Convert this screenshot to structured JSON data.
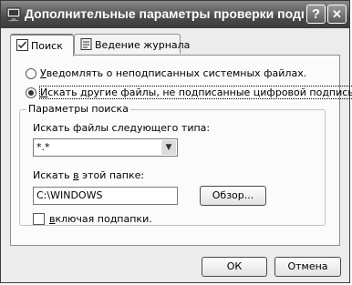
{
  "window": {
    "title": "Дополнительные параметры проверки подпи...",
    "help_btn": "?",
    "close_btn": "✕"
  },
  "tabs": [
    {
      "label": "Поиск",
      "active": true
    },
    {
      "label": "Ведение журнала",
      "active": false
    }
  ],
  "options": {
    "notify_pre": "У",
    "notify_rest": "ведомлять о неподписанных системных файлах.",
    "notify_selected": false,
    "search_pre": "И",
    "search_rest": "скать другие файлы, не подписанные цифровой подписью.",
    "search_selected": true
  },
  "search_params": {
    "legend": "Параметры поиска",
    "filetype_label": "Искать файлы следующего типа:",
    "filetype_value": "*.*",
    "folder_label_a": "Искать ",
    "folder_label_u": "в",
    "folder_label_b": " этой папке:",
    "folder_value": "C:\\WINDOWS",
    "browse_button": "Обзор...",
    "subfolders_label_u": "в",
    "subfolders_label_rest": "ключая подпапки.",
    "subfolders_checked": false
  },
  "footer": {
    "ok": "ОК",
    "cancel": "Отмена"
  }
}
